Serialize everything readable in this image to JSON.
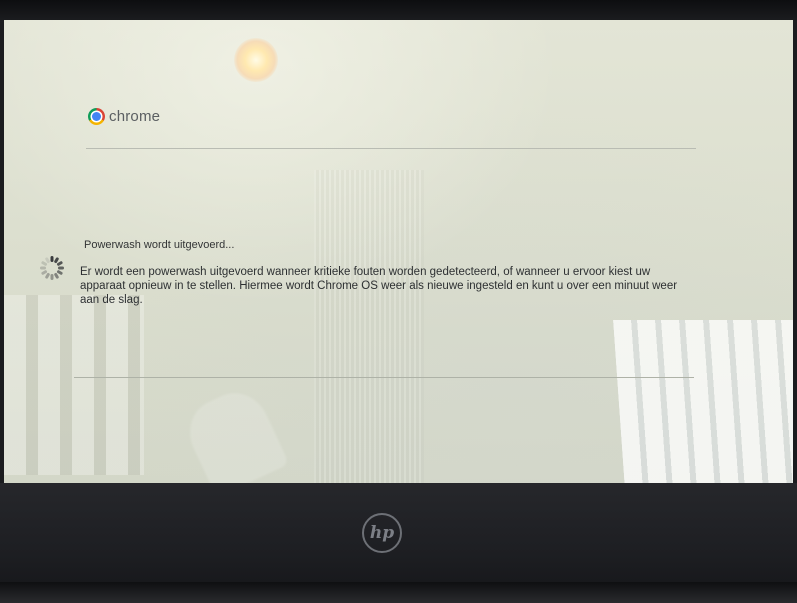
{
  "brand": {
    "logo_icon": "chrome-logo-icon",
    "name": "chrome"
  },
  "powerwash": {
    "status_icon": "loading-spinner-icon",
    "title": "Powerwash wordt uitgevoerd...",
    "message": "Er wordt een powerwash uitgevoerd wanneer kritieke fouten worden gedetecteerd, of wanneer u ervoor kiest uw apparaat opnieuw in te stellen. Hiermee wordt Chrome OS weer als nieuwe ingesteld en kunt u over een minuut weer aan de slag."
  },
  "device": {
    "logo_icon": "hp-logo-icon",
    "logo_text": "hp"
  },
  "colors": {
    "screen": "#dcdfcf",
    "bezel": "#1d1e22",
    "text": "#2d3032"
  }
}
